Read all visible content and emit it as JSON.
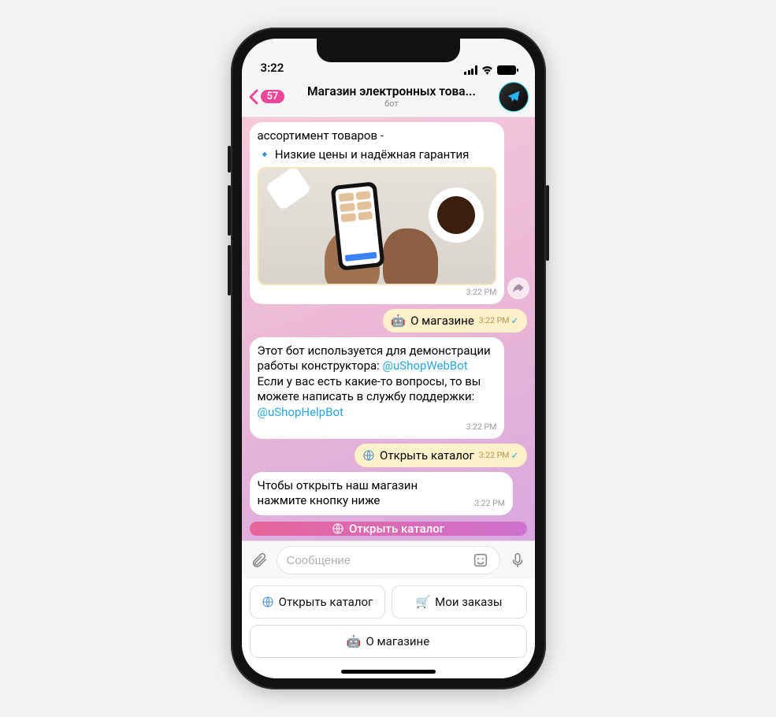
{
  "status": {
    "time": "3:22"
  },
  "header": {
    "back_badge": "57",
    "title": "Магазин электронных това...",
    "subtitle": "бот"
  },
  "messages": {
    "m1_line1": "ассортимент товаров -",
    "m1_line2": "🔹 Низкие цены и надёжная гарантия",
    "m1_ts": "3:22 PM",
    "m2_prefix": "🤖",
    "m2_text": "О магазине",
    "m2_ts": "3:22 PM",
    "m3_a": "Этот бот используется для демонстрации работы конструктора: ",
    "m3_link1": "@uShopWebBot",
    "m3_b": " Если у вас есть какие-то вопросы, то вы можете написать в службу поддержки: ",
    "m3_link2": "@uShopHelpBot",
    "m3_ts": "3:22 PM",
    "m4_prefix_icon": "globe",
    "m4_text": "Открыть каталог",
    "m4_ts": "3:22 PM",
    "m5_text": "Чтобы открыть наш магазин нажмите кнопку ниже",
    "m5_ts": "3:22 PM",
    "inline_btn": "Открыть каталог"
  },
  "input": {
    "placeholder": "Сообщение"
  },
  "keyboard": {
    "b1": "Открыть каталог",
    "b2": "Мои заказы",
    "b3": "О магазине"
  }
}
